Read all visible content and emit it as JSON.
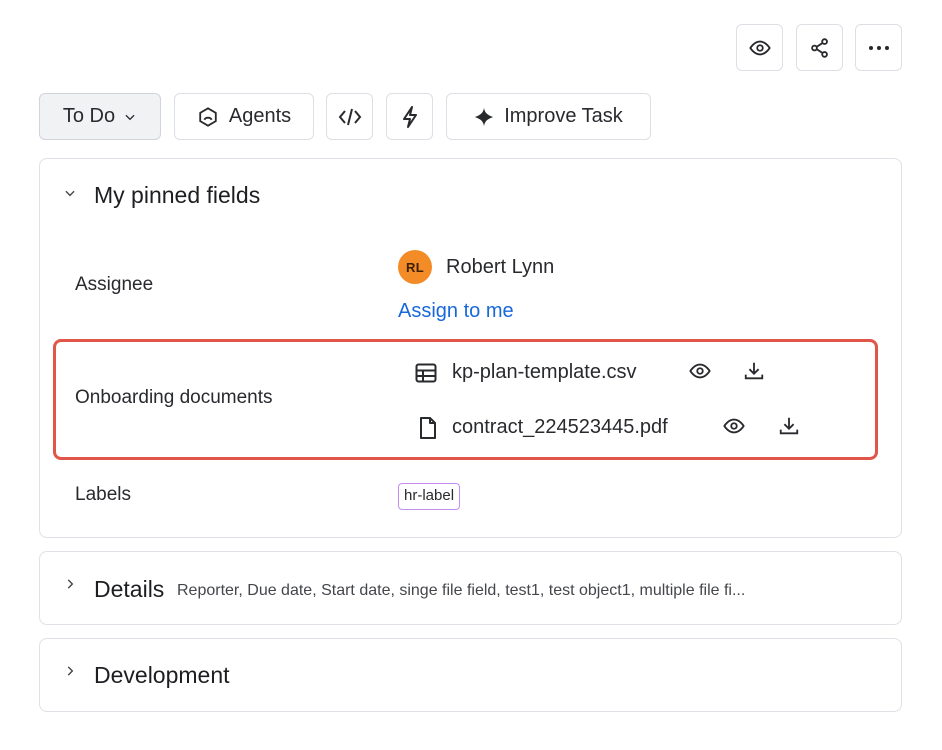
{
  "top_actions": {
    "watch_icon": "eye-icon",
    "share_icon": "share-icon",
    "more_icon": "more-horizontal-icon"
  },
  "toolbar": {
    "status_label": "To Do",
    "agents_label": "Agents",
    "improve_label": "Improve Task"
  },
  "pinned": {
    "title": "My pinned fields",
    "assignee": {
      "label": "Assignee",
      "avatar_initials": "RL",
      "name": "Robert Lynn",
      "assign_link": "Assign to me"
    },
    "onboarding": {
      "label": "Onboarding documents",
      "files": [
        {
          "name": "kp-plan-template.csv",
          "icon": "table-file-icon"
        },
        {
          "name": "contract_224523445.pdf",
          "icon": "document-file-icon"
        }
      ]
    },
    "labels": {
      "label": "Labels",
      "tag": "hr-label"
    }
  },
  "details": {
    "title": "Details",
    "summary": "Reporter, Due date, Start date, singe file field, test1, test object1, multiple file fi..."
  },
  "development": {
    "title": "Development"
  },
  "colors": {
    "link": "#1868db",
    "highlight": "#e0574a",
    "avatar": "#f38b26",
    "tag_border": "#c38ef2"
  }
}
